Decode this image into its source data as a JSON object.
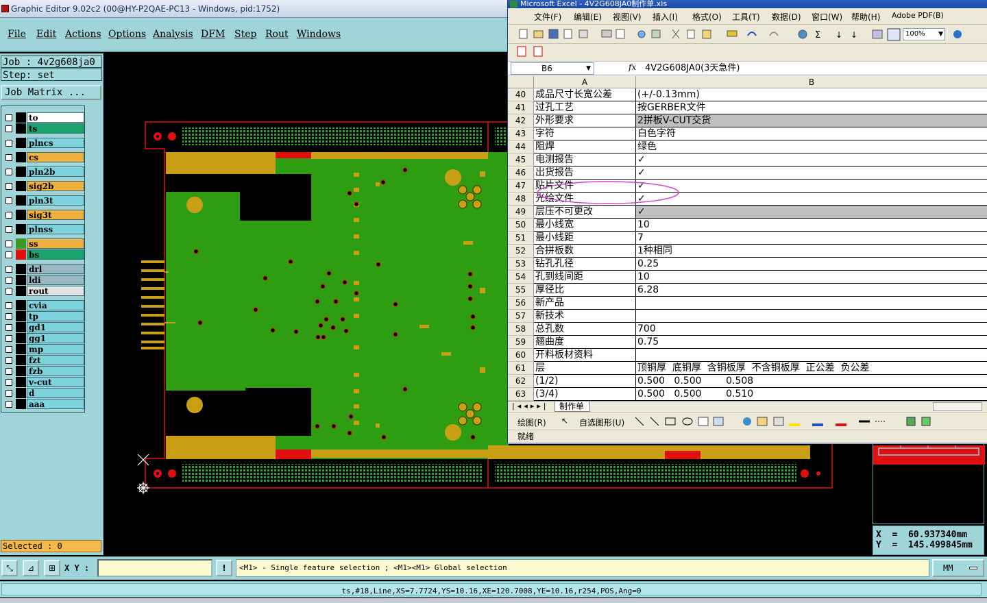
{
  "graphic_editor": {
    "title": "Graphic Editor 9.02c2 (00@HY-P2QAE-PC13 - Windows, pid:1752)",
    "menu": [
      "File",
      "Edit",
      "Actions",
      "Options",
      "Analysis",
      "DFM",
      "Step",
      "Rout",
      "Windows"
    ],
    "job": "Job : 4v2g608ja0",
    "step": "Step: set",
    "job_matrix_button": "Job Matrix ...",
    "layers": [
      {
        "name": "to",
        "color": "#ffffff",
        "swatch": "#000000"
      },
      {
        "name": "ts",
        "color": "#1aa36b",
        "swatch": "#000000"
      },
      {
        "name": "plncs",
        "color": "#7fd3df",
        "swatch": "#000000"
      },
      {
        "name": "cs",
        "color": "#f0b040",
        "swatch": "#000000"
      },
      {
        "name": "pln2b",
        "color": "#7fd3df",
        "swatch": "#000000"
      },
      {
        "name": "sig2b",
        "color": "#f0b040",
        "swatch": "#000000"
      },
      {
        "name": "pln3t",
        "color": "#7fd3df",
        "swatch": "#000000"
      },
      {
        "name": "sig3t",
        "color": "#f0b040",
        "swatch": "#000000"
      },
      {
        "name": "plnss",
        "color": "#7fd3df",
        "swatch": "#000000"
      },
      {
        "name": "ss",
        "color": "#f0b040",
        "swatch": "#3a9a24"
      },
      {
        "name": "bs",
        "color": "#1aa36b",
        "swatch": "#e01010"
      },
      {
        "name": "drl",
        "color": "#9cb8c4",
        "swatch": "#000000"
      },
      {
        "name": "ldi",
        "color": "#9cb8c4",
        "swatch": "#000000"
      },
      {
        "name": "rout",
        "color": "#e4e4e4",
        "swatch": "#000000"
      },
      {
        "name": "cvia",
        "color": "#7fd3df",
        "swatch": "#000000"
      },
      {
        "name": "tp",
        "color": "#7fd3df",
        "swatch": "#000000"
      },
      {
        "name": "gd1",
        "color": "#7fd3df",
        "swatch": "#000000"
      },
      {
        "name": "gg1",
        "color": "#7fd3df",
        "swatch": "#000000"
      },
      {
        "name": "mp",
        "color": "#7fd3df",
        "swatch": "#000000"
      },
      {
        "name": "fzt",
        "color": "#7fd3df",
        "swatch": "#000000"
      },
      {
        "name": "fzb",
        "color": "#7fd3df",
        "swatch": "#000000"
      },
      {
        "name": "v-cut",
        "color": "#7fd3df",
        "swatch": "#000000"
      },
      {
        "name": "d",
        "color": "#7fd3df",
        "swatch": "#000000"
      },
      {
        "name": "aaa",
        "color": "#7fd3df",
        "swatch": "#000000"
      }
    ],
    "selected": "Selected : 0",
    "xy_label": "X Y :",
    "message": "<M1> - Single feature selection ; <M1><M1> Global selection",
    "unit": "MM",
    "feature_info": "ts,#18,Line,XS=7.7724,YS=10.16,XE=120.7008,YE=10.16,r254,POS,Ang=0",
    "coord_x": "X  =  60.937340mm",
    "coord_y": "Y  =  145.499845mm"
  },
  "excel": {
    "title": "Microsoft Excel - 4V2G608JA0制作单.xls",
    "menu": [
      "文件(F)",
      "编辑(E)",
      "视图(V)",
      "插入(I)",
      "格式(O)",
      "工具(T)",
      "数据(D)",
      "窗口(W)",
      "帮助(H)",
      "Adobe PDF(B)"
    ],
    "zoom": "100%",
    "name_box": "B6",
    "formula": "4V2G608JA0(3天急件)",
    "col_a": "A",
    "col_b": "B",
    "rows": [
      {
        "n": "40",
        "a": "成品尺寸长宽公差",
        "b": "(+/-0.13mm)"
      },
      {
        "n": "41",
        "a": "过孔工艺",
        "b": "按GERBER文件"
      },
      {
        "n": "42",
        "a": "外形要求",
        "b": "2拼板V-CUT交货",
        "gray": true
      },
      {
        "n": "43",
        "a": "字符",
        "b": "白色字符"
      },
      {
        "n": "44",
        "a": "阻焊",
        "b": "绿色"
      },
      {
        "n": "45",
        "a": "电测报告",
        "b": "✓"
      },
      {
        "n": "46",
        "a": "出货报告",
        "b": "✓"
      },
      {
        "n": "47",
        "a": "贴片文件",
        "b": "✓"
      },
      {
        "n": "48",
        "a": "光绘文件",
        "b": "✓"
      },
      {
        "n": "49",
        "a": "层压不可更改",
        "b": "✓",
        "gray": true
      },
      {
        "n": "50",
        "a": "最小线宽",
        "b": "10"
      },
      {
        "n": "51",
        "a": "最小线距",
        "b": "7"
      },
      {
        "n": "52",
        "a": "合拼板数",
        "b": "1种相同"
      },
      {
        "n": "53",
        "a": "钻孔孔径",
        "b": "0.25"
      },
      {
        "n": "54",
        "a": "孔到线间距",
        "b": "10"
      },
      {
        "n": "55",
        "a": "厚径比",
        "b": "6.28"
      },
      {
        "n": "56",
        "a": "新产品",
        "b": ""
      },
      {
        "n": "57",
        "a": "新技术",
        "b": ""
      },
      {
        "n": "58",
        "a": "总孔数",
        "b": "700"
      },
      {
        "n": "59",
        "a": "翘曲度",
        "b": "0.75"
      },
      {
        "n": "60",
        "a": "开料板材资料",
        "b": ""
      },
      {
        "n": "61",
        "a": "层",
        "b": "顶铜厚  底铜厚  含铜板厚  不含铜板厚  正公差  负公差"
      },
      {
        "n": "62",
        "a": "(1/2)",
        "b": "0.500   0.500        0.508"
      },
      {
        "n": "63",
        "a": "(3/4)",
        "b": "0.500   0.500        0.510"
      }
    ],
    "sheet_tab": "制作单",
    "draw_label": "绘图(R)",
    "autoshape_label": "自选图形(U)",
    "status": "就绪"
  }
}
